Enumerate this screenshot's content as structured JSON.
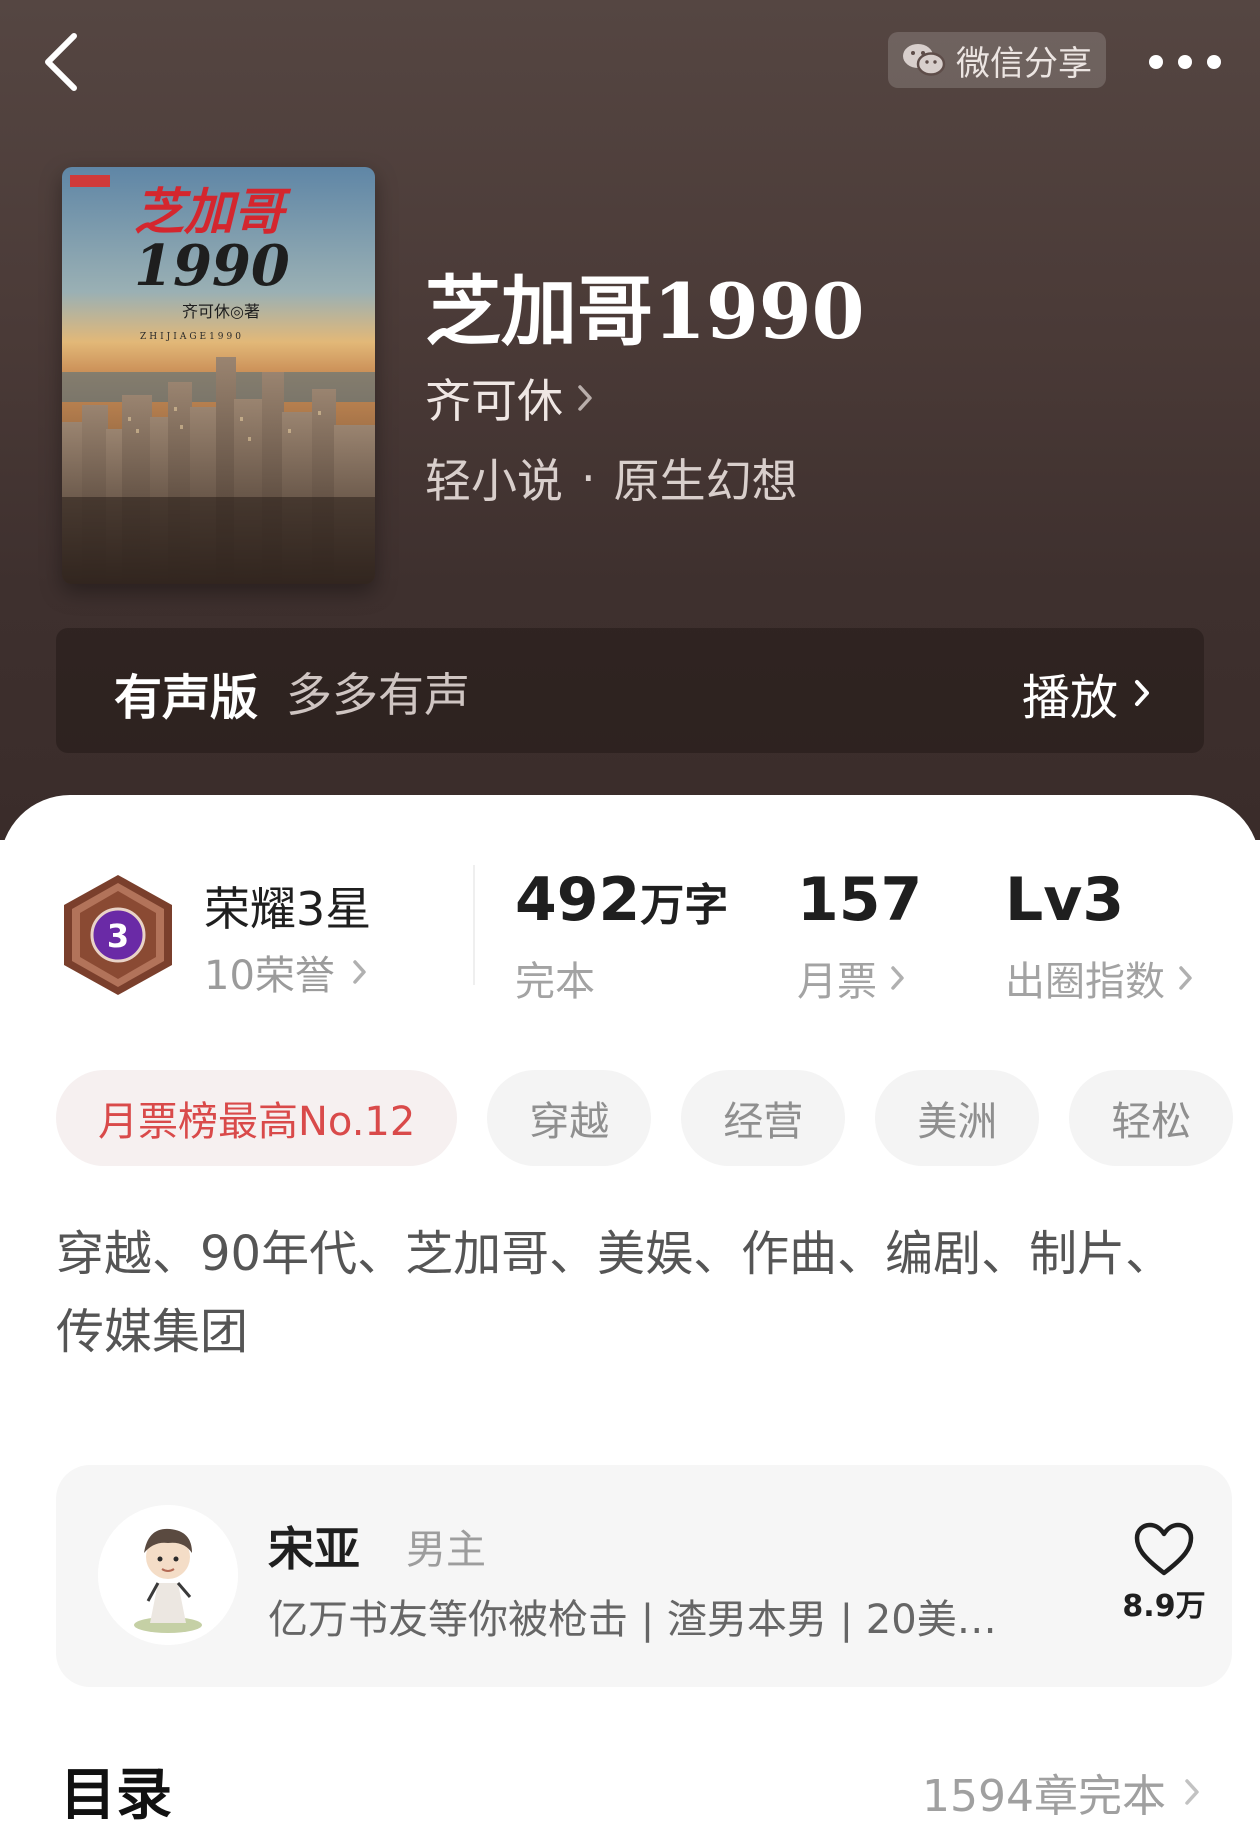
{
  "header": {
    "share_label": "微信分享"
  },
  "book": {
    "cover": {
      "title_line1": "芝加哥",
      "title_line2": "1990",
      "author_line": "齐可休◎著",
      "pinyin": "ZHIJIAGE1990"
    },
    "title": "芝加哥1990",
    "author": "齐可休",
    "category": "轻小说",
    "subcategory": "原生幻想"
  },
  "audio": {
    "label": "有声版",
    "source": "多多有声",
    "play_label": "播放"
  },
  "honor": {
    "title": "荣耀3星",
    "subtitle": "10荣誉",
    "badge_number": "3"
  },
  "stats": {
    "words_value": "492",
    "words_unit": "万字",
    "words_label": "完本",
    "tickets_value": "157",
    "tickets_label": "月票",
    "index_value": "Lv3",
    "index_label": "出圈指数"
  },
  "tags": [
    "月票榜最高No.12",
    "穿越",
    "经营",
    "美洲",
    "轻松"
  ],
  "description": "穿越、90年代、芝加哥、美娱、作曲、编剧、制片、传媒集团",
  "character": {
    "name": "宋亚",
    "role": "男主",
    "description": "亿万书友等你被枪击 | 渣男本男 | 20美…",
    "likes": "8.9万"
  },
  "toc": {
    "title": "目录",
    "status": "1594章完本"
  },
  "colors": {
    "hero_bg": "#4a3a37",
    "rank_tag": "#d94a4a",
    "badge_purple": "#6a2aa6",
    "badge_bronze": "#8a4a33"
  }
}
